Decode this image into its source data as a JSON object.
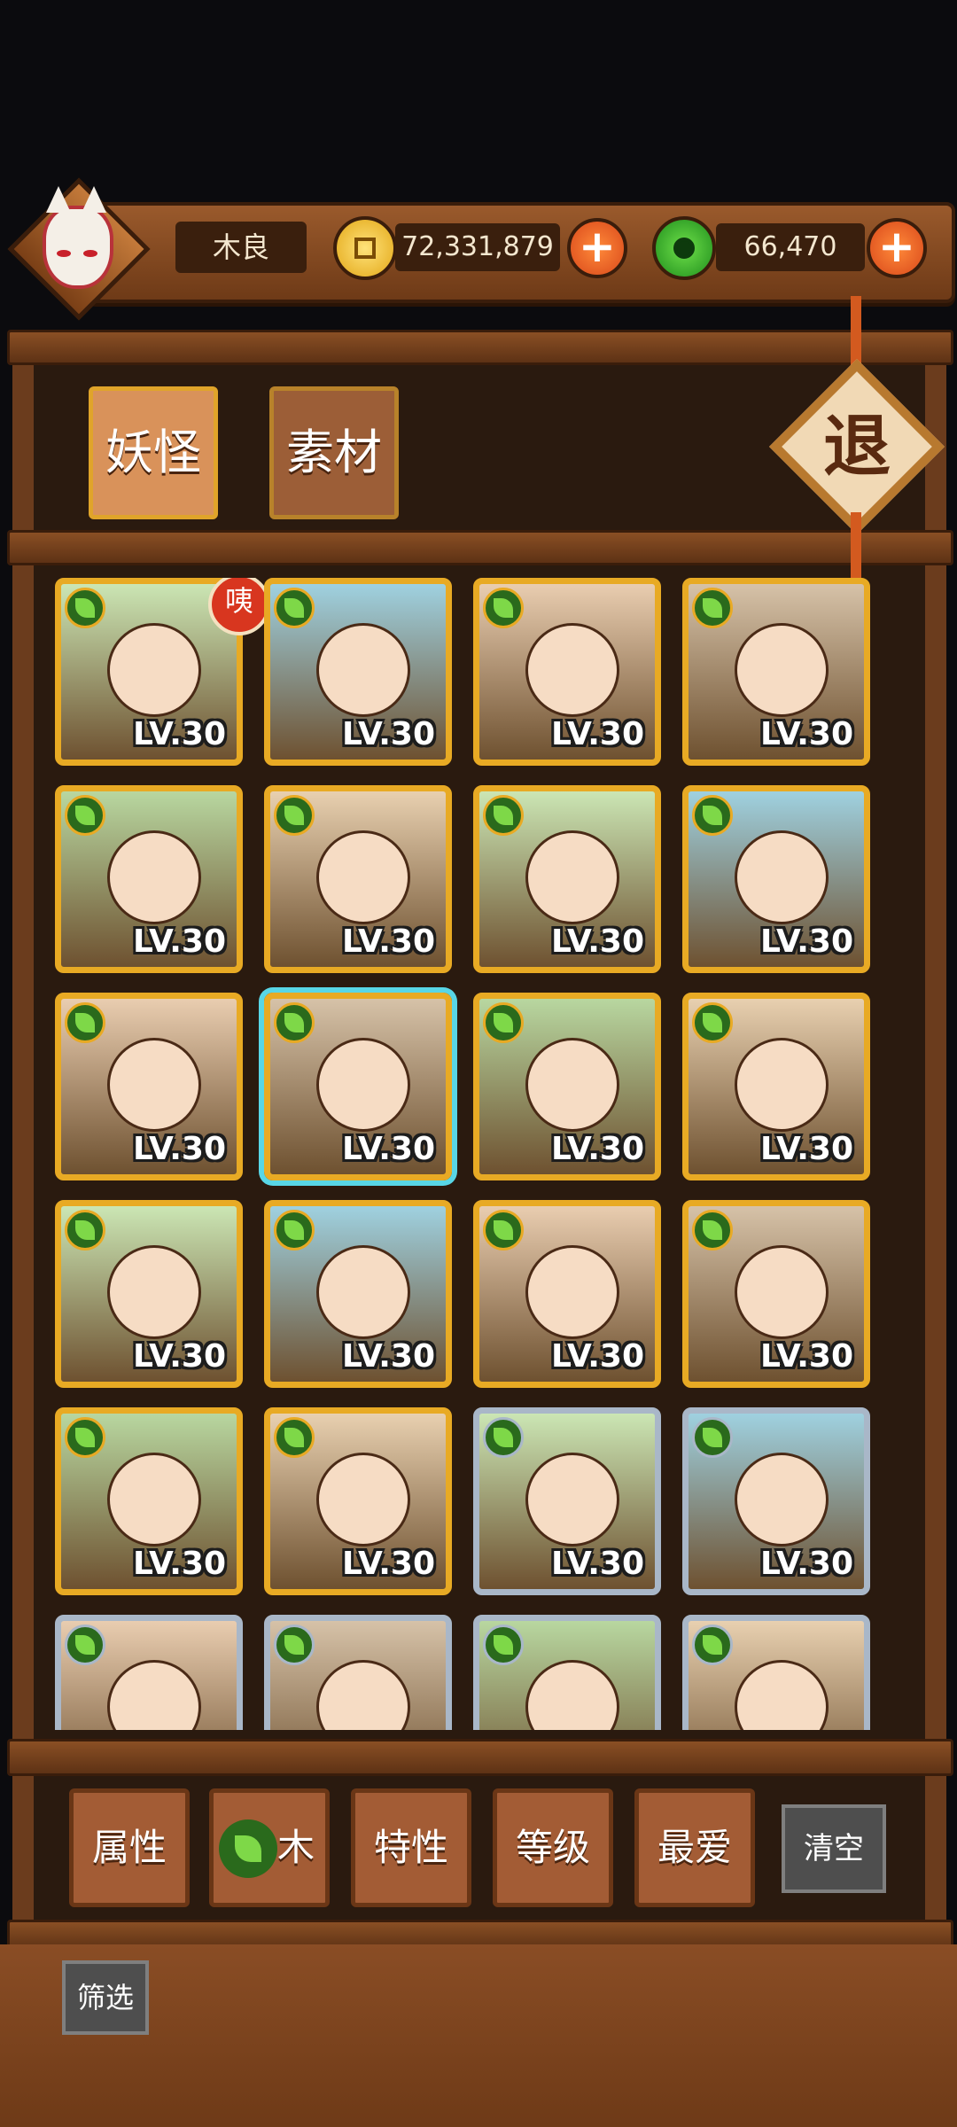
{
  "player": {
    "name": "木良",
    "gold": "72,331,879",
    "jade": "66,470"
  },
  "tabs": {
    "yokai": "妖怪",
    "materials": "素材"
  },
  "exit_label": "退",
  "cards": [
    {
      "level": "LV.30",
      "frame": "gold",
      "badge": "咦"
    },
    {
      "level": "LV.30",
      "frame": "gold"
    },
    {
      "level": "LV.30",
      "frame": "gold"
    },
    {
      "level": "LV.30",
      "frame": "gold"
    },
    {
      "level": "LV.30",
      "frame": "gold"
    },
    {
      "level": "LV.30",
      "frame": "gold"
    },
    {
      "level": "LV.30",
      "frame": "gold"
    },
    {
      "level": "LV.30",
      "frame": "gold"
    },
    {
      "level": "LV.30",
      "frame": "gold"
    },
    {
      "level": "LV.30",
      "frame": "gold",
      "selected": true
    },
    {
      "level": "LV.30",
      "frame": "gold"
    },
    {
      "level": "LV.30",
      "frame": "gold"
    },
    {
      "level": "LV.30",
      "frame": "gold"
    },
    {
      "level": "LV.30",
      "frame": "gold"
    },
    {
      "level": "LV.30",
      "frame": "gold"
    },
    {
      "level": "LV.30",
      "frame": "gold"
    },
    {
      "level": "LV.30",
      "frame": "gold"
    },
    {
      "level": "LV.30",
      "frame": "gold"
    },
    {
      "level": "LV.30",
      "frame": "silver"
    },
    {
      "level": "LV.30",
      "frame": "silver"
    },
    {
      "level": "",
      "frame": "silver"
    },
    {
      "level": "",
      "frame": "silver"
    },
    {
      "level": "",
      "frame": "silver"
    },
    {
      "level": "",
      "frame": "silver"
    }
  ],
  "filters": {
    "attribute": "属性",
    "element": "木",
    "trait": "特性",
    "level": "等级",
    "favorite": "最爱",
    "clear": "清空"
  },
  "filter_toggle": "筛选",
  "colors": {
    "gold_frame": "#e8aa24",
    "silver_frame": "#a9b7c8",
    "wood": "#6b3c1d",
    "selected_glow": "#58d6e6"
  },
  "icons": {
    "element": "leaf-icon",
    "currency1": "gold-coin-icon",
    "currency2": "jade-coin-icon",
    "add": "plus-icon"
  }
}
